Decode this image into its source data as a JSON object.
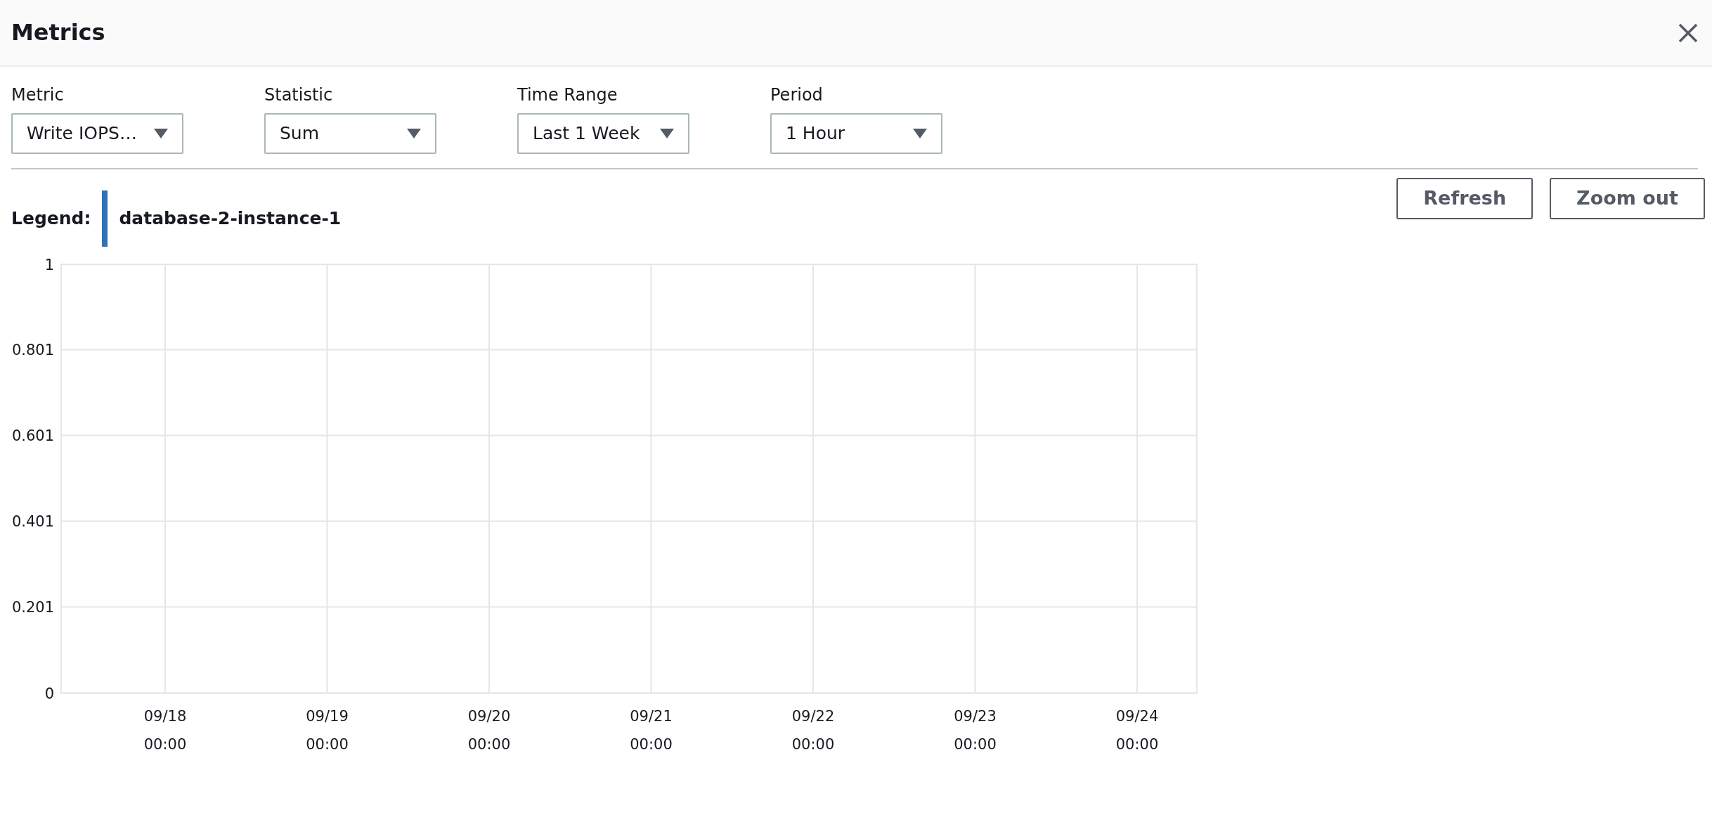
{
  "window": {
    "title": "Metrics"
  },
  "controls": [
    {
      "label": "Metric",
      "value": "Write IOPS…"
    },
    {
      "label": "Statistic",
      "value": "Sum"
    },
    {
      "label": "Time Range",
      "value": "Last 1 Week"
    },
    {
      "label": "Period",
      "value": "1 Hour"
    }
  ],
  "buttons": [
    "Refresh",
    "Zoom out"
  ],
  "legend": {
    "label": "Legend:"
  },
  "chart": {
    "chart_data": {
      "type": "line",
      "categories": [
        "09/18 00:00",
        "09/19 00:00",
        "09/20 00:00",
        "09/21 00:00",
        "09/22 00:00",
        "09/23 00:00",
        "09/24 00:00"
      ],
      "series": [
        {
          "name": "database-2-instance-1",
          "color": "#2e73b8",
          "values": [
            null,
            null,
            null,
            null,
            null,
            null,
            null
          ]
        }
      ],
      "grid": true,
      "ylim": [
        0,
        1
      ],
      "yticks": [
        0,
        0.201,
        0.401,
        0.601,
        0.801,
        1
      ]
    }
  }
}
